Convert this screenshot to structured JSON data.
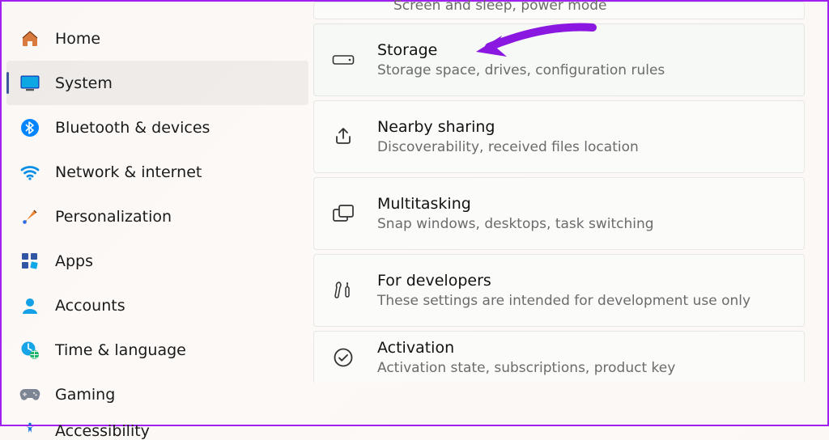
{
  "sidebar": {
    "items": [
      {
        "label": "Home"
      },
      {
        "label": "System"
      },
      {
        "label": "Bluetooth & devices"
      },
      {
        "label": "Network & internet"
      },
      {
        "label": "Personalization"
      },
      {
        "label": "Apps"
      },
      {
        "label": "Accounts"
      },
      {
        "label": "Time & language"
      },
      {
        "label": "Gaming"
      },
      {
        "label": "Accessibility"
      }
    ],
    "selected_index": 1
  },
  "content": {
    "cards": [
      {
        "title": "",
        "sub": "Screen and sleep, power mode"
      },
      {
        "title": "Storage",
        "sub": "Storage space, drives, configuration rules"
      },
      {
        "title": "Nearby sharing",
        "sub": "Discoverability, received files location"
      },
      {
        "title": "Multitasking",
        "sub": "Snap windows, desktops, task switching"
      },
      {
        "title": "For developers",
        "sub": "These settings are intended for development use only"
      },
      {
        "title": "Activation",
        "sub": "Activation state, subscriptions, product key"
      }
    ]
  },
  "annotation": {
    "arrow_color": "#8a18e0"
  }
}
